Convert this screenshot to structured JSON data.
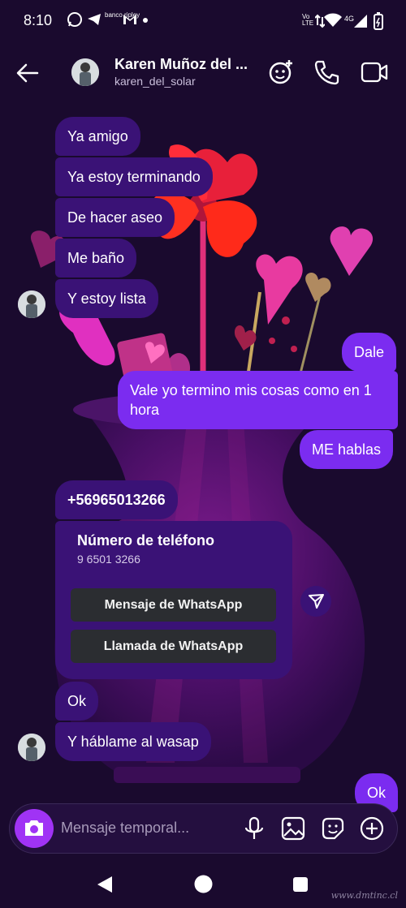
{
  "status_bar": {
    "time": "8:10",
    "notification_icons": [
      "whatsapp-icon",
      "telegram-icon",
      "banco-ripley-icon",
      "gmail-icon",
      "dot-icon"
    ],
    "banco_label": "banco ripley",
    "volte": "Vo LTE",
    "network": "4G",
    "indicator_icons": [
      "volte-icon",
      "data-arrows-icon",
      "wifi-icon",
      "signal-icon",
      "battery-icon"
    ]
  },
  "header": {
    "contact_name": "Karen Muñoz del ...",
    "username": "karen_del_solar",
    "icons": [
      "back-arrow-icon",
      "effects-icon",
      "phone-call-icon",
      "video-call-icon"
    ]
  },
  "messages": [
    {
      "side": "in",
      "text": "Ya amigo"
    },
    {
      "side": "in",
      "text": "Ya estoy terminando"
    },
    {
      "side": "in",
      "text": "De hacer aseo"
    },
    {
      "side": "in",
      "text": "Me baño"
    },
    {
      "side": "in",
      "text": "Y estoy lista"
    },
    {
      "side": "out",
      "text": "Dale"
    },
    {
      "side": "out",
      "text": "Vale yo termino mis cosas como en 1 hora"
    },
    {
      "side": "out",
      "text": "ME hablas"
    },
    {
      "side": "in",
      "text": "+56965013266"
    },
    {
      "side": "in",
      "text": "Ok"
    },
    {
      "side": "in",
      "text": "Y háblame al wasap"
    },
    {
      "side": "out",
      "text": "Ok"
    }
  ],
  "contact_card": {
    "title": "Número de teléfono",
    "number": "9 6501 3266",
    "button_message": "Mensaje de WhatsApp",
    "button_call": "Llamada de WhatsApp"
  },
  "composer": {
    "placeholder": "Mensaje temporal...",
    "icons": [
      "camera-icon",
      "microphone-icon",
      "gallery-icon",
      "sticker-icon",
      "plus-icon"
    ]
  },
  "nav_bar": {
    "icons": [
      "back-triangle-icon",
      "home-circle-icon",
      "recents-square-icon"
    ]
  },
  "watermark": "www.dmtinc.cl",
  "colors": {
    "background": "#1a0a2e",
    "incoming_bubble": "#3a1276",
    "outgoing_bubble": "#7b2cf0",
    "camera_button": "#a033f5",
    "card_button": "#2b2d31"
  }
}
